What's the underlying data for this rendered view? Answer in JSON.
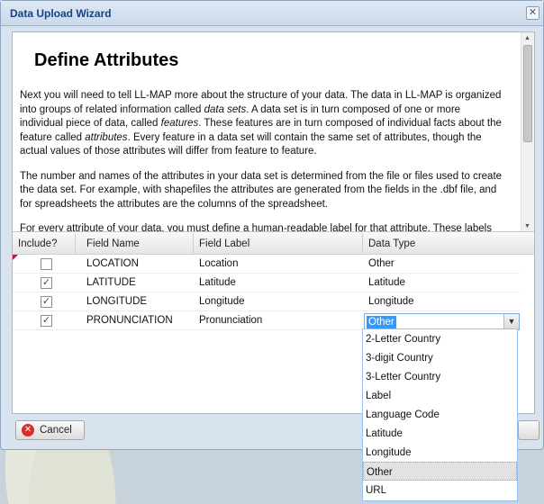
{
  "window": {
    "title": "Data Upload Wizard"
  },
  "content": {
    "heading": "Define Attributes",
    "paragraphs": [
      "Next you will need to tell LL-MAP more about the structure of your data. The data in LL-MAP is organized into groups of related information called data sets. A data set is in turn composed of one or more individual piece of data, called features. These features are in turn composed of individual facts about the feature called attributes. Every feature in a data set will contain the same set of attributes, though the actual values of those attributes will differ from feature to feature.",
      "The number and names of the attributes in your data set is determined from the file or files used to create the data set. For example, with shapefiles the attributes are generated from the fields in the .dbf file, and for spreadsheets the attributes are the columns of the spreadsheet.",
      "For every attribute of your data, you must define a human-readable label for that attribute. These labels will be used to build default feature templates and to help you build your feature templates."
    ]
  },
  "grid": {
    "columns": [
      "Include?",
      "Field Name",
      "Field Label",
      "Data Type"
    ],
    "rows": [
      {
        "include": false,
        "field_name": "LOCATION",
        "field_label": "Location",
        "data_type": "Other"
      },
      {
        "include": true,
        "field_name": "LATITUDE",
        "field_label": "Latitude",
        "data_type": "Latitude"
      },
      {
        "include": true,
        "field_name": "LONGITUDE",
        "field_label": "Longitude",
        "data_type": "Longitude"
      },
      {
        "include": true,
        "field_name": "PRONUNCIATION",
        "field_label": "Pronunciation",
        "data_type": "Other"
      }
    ],
    "check_glyph": "✓"
  },
  "combo": {
    "value": "Other",
    "options": [
      "2-Letter Country",
      "3-digit Country",
      "3-Letter Country",
      "Label",
      "Language Code",
      "Latitude",
      "Longitude",
      "Other",
      "URL"
    ],
    "selected_index": 7
  },
  "footer": {
    "cancel_label": "Cancel"
  },
  "icons": {
    "close": "close-icon",
    "cancel": "cancel-icon",
    "dropdown": "chevron-down-icon"
  }
}
